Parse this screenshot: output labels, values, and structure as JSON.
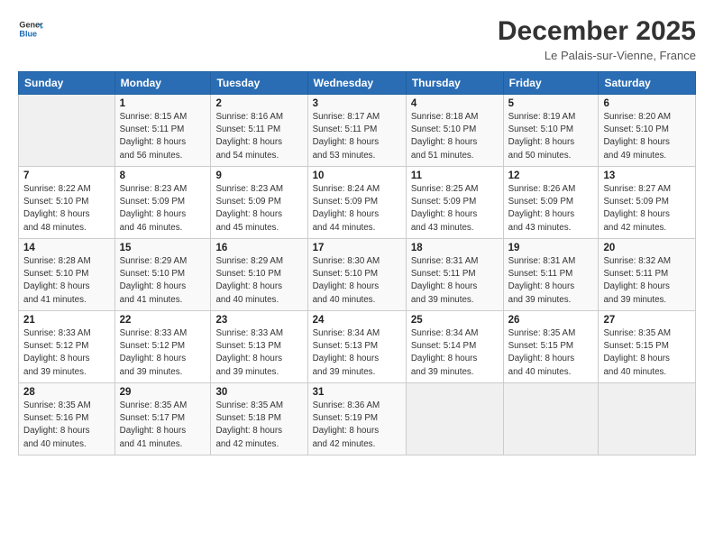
{
  "header": {
    "logo_line1": "General",
    "logo_line2": "Blue",
    "month": "December 2025",
    "location": "Le Palais-sur-Vienne, France"
  },
  "weekdays": [
    "Sunday",
    "Monday",
    "Tuesday",
    "Wednesday",
    "Thursday",
    "Friday",
    "Saturday"
  ],
  "weeks": [
    [
      {
        "day": "",
        "info": ""
      },
      {
        "day": "1",
        "info": "Sunrise: 8:15 AM\nSunset: 5:11 PM\nDaylight: 8 hours\nand 56 minutes."
      },
      {
        "day": "2",
        "info": "Sunrise: 8:16 AM\nSunset: 5:11 PM\nDaylight: 8 hours\nand 54 minutes."
      },
      {
        "day": "3",
        "info": "Sunrise: 8:17 AM\nSunset: 5:11 PM\nDaylight: 8 hours\nand 53 minutes."
      },
      {
        "day": "4",
        "info": "Sunrise: 8:18 AM\nSunset: 5:10 PM\nDaylight: 8 hours\nand 51 minutes."
      },
      {
        "day": "5",
        "info": "Sunrise: 8:19 AM\nSunset: 5:10 PM\nDaylight: 8 hours\nand 50 minutes."
      },
      {
        "day": "6",
        "info": "Sunrise: 8:20 AM\nSunset: 5:10 PM\nDaylight: 8 hours\nand 49 minutes."
      }
    ],
    [
      {
        "day": "7",
        "info": "Sunrise: 8:22 AM\nSunset: 5:10 PM\nDaylight: 8 hours\nand 48 minutes."
      },
      {
        "day": "8",
        "info": "Sunrise: 8:23 AM\nSunset: 5:09 PM\nDaylight: 8 hours\nand 46 minutes."
      },
      {
        "day": "9",
        "info": "Sunrise: 8:23 AM\nSunset: 5:09 PM\nDaylight: 8 hours\nand 45 minutes."
      },
      {
        "day": "10",
        "info": "Sunrise: 8:24 AM\nSunset: 5:09 PM\nDaylight: 8 hours\nand 44 minutes."
      },
      {
        "day": "11",
        "info": "Sunrise: 8:25 AM\nSunset: 5:09 PM\nDaylight: 8 hours\nand 43 minutes."
      },
      {
        "day": "12",
        "info": "Sunrise: 8:26 AM\nSunset: 5:09 PM\nDaylight: 8 hours\nand 43 minutes."
      },
      {
        "day": "13",
        "info": "Sunrise: 8:27 AM\nSunset: 5:09 PM\nDaylight: 8 hours\nand 42 minutes."
      }
    ],
    [
      {
        "day": "14",
        "info": "Sunrise: 8:28 AM\nSunset: 5:10 PM\nDaylight: 8 hours\nand 41 minutes."
      },
      {
        "day": "15",
        "info": "Sunrise: 8:29 AM\nSunset: 5:10 PM\nDaylight: 8 hours\nand 41 minutes."
      },
      {
        "day": "16",
        "info": "Sunrise: 8:29 AM\nSunset: 5:10 PM\nDaylight: 8 hours\nand 40 minutes."
      },
      {
        "day": "17",
        "info": "Sunrise: 8:30 AM\nSunset: 5:10 PM\nDaylight: 8 hours\nand 40 minutes."
      },
      {
        "day": "18",
        "info": "Sunrise: 8:31 AM\nSunset: 5:11 PM\nDaylight: 8 hours\nand 39 minutes."
      },
      {
        "day": "19",
        "info": "Sunrise: 8:31 AM\nSunset: 5:11 PM\nDaylight: 8 hours\nand 39 minutes."
      },
      {
        "day": "20",
        "info": "Sunrise: 8:32 AM\nSunset: 5:11 PM\nDaylight: 8 hours\nand 39 minutes."
      }
    ],
    [
      {
        "day": "21",
        "info": "Sunrise: 8:33 AM\nSunset: 5:12 PM\nDaylight: 8 hours\nand 39 minutes."
      },
      {
        "day": "22",
        "info": "Sunrise: 8:33 AM\nSunset: 5:12 PM\nDaylight: 8 hours\nand 39 minutes."
      },
      {
        "day": "23",
        "info": "Sunrise: 8:33 AM\nSunset: 5:13 PM\nDaylight: 8 hours\nand 39 minutes."
      },
      {
        "day": "24",
        "info": "Sunrise: 8:34 AM\nSunset: 5:13 PM\nDaylight: 8 hours\nand 39 minutes."
      },
      {
        "day": "25",
        "info": "Sunrise: 8:34 AM\nSunset: 5:14 PM\nDaylight: 8 hours\nand 39 minutes."
      },
      {
        "day": "26",
        "info": "Sunrise: 8:35 AM\nSunset: 5:15 PM\nDaylight: 8 hours\nand 40 minutes."
      },
      {
        "day": "27",
        "info": "Sunrise: 8:35 AM\nSunset: 5:15 PM\nDaylight: 8 hours\nand 40 minutes."
      }
    ],
    [
      {
        "day": "28",
        "info": "Sunrise: 8:35 AM\nSunset: 5:16 PM\nDaylight: 8 hours\nand 40 minutes."
      },
      {
        "day": "29",
        "info": "Sunrise: 8:35 AM\nSunset: 5:17 PM\nDaylight: 8 hours\nand 41 minutes."
      },
      {
        "day": "30",
        "info": "Sunrise: 8:35 AM\nSunset: 5:18 PM\nDaylight: 8 hours\nand 42 minutes."
      },
      {
        "day": "31",
        "info": "Sunrise: 8:36 AM\nSunset: 5:19 PM\nDaylight: 8 hours\nand 42 minutes."
      },
      {
        "day": "",
        "info": ""
      },
      {
        "day": "",
        "info": ""
      },
      {
        "day": "",
        "info": ""
      }
    ]
  ]
}
